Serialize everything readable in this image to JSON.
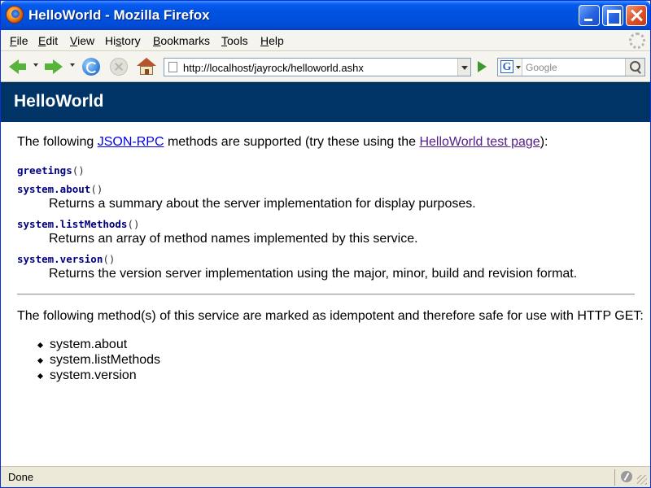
{
  "window": {
    "title": "HelloWorld - Mozilla Firefox"
  },
  "menubar": {
    "items": [
      {
        "label": "File",
        "accel": "F"
      },
      {
        "label": "Edit",
        "accel": "E"
      },
      {
        "label": "View",
        "accel": "V"
      },
      {
        "label": "History",
        "accel": "s"
      },
      {
        "label": "Bookmarks",
        "accel": "B"
      },
      {
        "label": "Tools",
        "accel": "T"
      },
      {
        "label": "Help",
        "accel": "H"
      }
    ]
  },
  "toolbar": {
    "url": "http://localhost/jayrock/helloworld.ashx",
    "search_placeholder": "Google",
    "search_engine_letter": "G"
  },
  "page": {
    "heading": "HelloWorld",
    "intro": {
      "prefix": "The following ",
      "link1": "JSON-RPC",
      "middle": " methods are supported (try these using the ",
      "link2": "HelloWorld test page",
      "suffix": "):"
    },
    "methods": [
      {
        "name": "greetings",
        "parens": "()",
        "description": ""
      },
      {
        "name": "system.about",
        "parens": "()",
        "description": "Returns a summary about the server implementation for display purposes."
      },
      {
        "name": "system.listMethods",
        "parens": "()",
        "description": "Returns an array of method names implemented by this service."
      },
      {
        "name": "system.version",
        "parens": "()",
        "description": "Returns the version server implementation using the major, minor, build and revision format."
      }
    ],
    "idempotent_intro": "The following method(s) of this service are marked as idempotent and therefore safe for use with HTTP GET:",
    "idempotent_methods": [
      "system.about",
      "system.listMethods",
      "system.version"
    ]
  },
  "statusbar": {
    "text": "Done"
  },
  "colors": {
    "banner": "#003366",
    "link": "#0000ee",
    "visited_link": "#551a8b",
    "method_name": "#000080",
    "titlebar": "#0053e1"
  },
  "icons": {
    "back": "back-arrow-icon",
    "forward": "forward-arrow-icon",
    "reload": "reload-icon",
    "stop": "stop-icon",
    "home": "home-icon",
    "go": "go-arrow-icon",
    "search": "magnifier-icon"
  }
}
